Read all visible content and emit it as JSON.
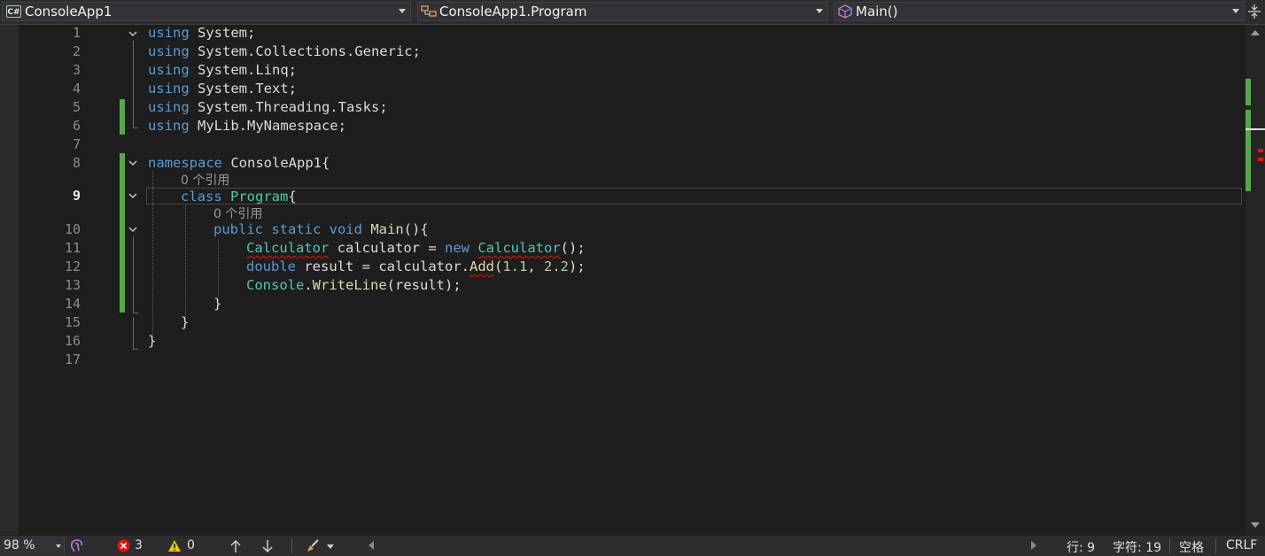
{
  "navbar": {
    "project": "ConsoleApp1",
    "project_icon": "C#",
    "class_scope": "ConsoleApp1.Program",
    "member_scope": "Main()"
  },
  "editor": {
    "line_numbers": [
      "1",
      "2",
      "3",
      "4",
      "5",
      "6",
      "7",
      "8",
      "9",
      "10",
      "11",
      "12",
      "13",
      "14",
      "15",
      "16",
      "17"
    ],
    "current_line": "9",
    "codelens_program": "0 个引用",
    "codelens_main": "0 个引用",
    "lines": {
      "l1": {
        "kw": "using",
        "rest": " System;"
      },
      "l2": {
        "kw": "using",
        "rest": " System.Collections.Generic;"
      },
      "l3": {
        "kw": "using",
        "rest": " System.Linq;"
      },
      "l4": {
        "kw": "using",
        "rest": " System.Text;"
      },
      "l5": {
        "kw": "using",
        "rest": " System.Threading.Tasks;"
      },
      "l6": {
        "kw": "using",
        "rest": " MyLib.MyNamespace;"
      },
      "l8": {
        "kw": "namespace",
        "rest": " ConsoleApp1{"
      },
      "l9": {
        "kw": "class",
        "name": "Program",
        "brace": "{"
      },
      "l10": {
        "mods": "public static void",
        "name": "Main",
        "rest": "(){"
      },
      "l11": {
        "type": "Calculator",
        "var": " calculator",
        "op": " = ",
        "kw": "new",
        "type2": "Calculator",
        "rest": "();"
      },
      "l12": {
        "kw": "double",
        "var": " result",
        "op": " = ",
        "obj": "calculator",
        "dot": ".",
        "meth": "Add",
        "open": "(",
        "n1": "1.1",
        "comma": ", ",
        "n2": "2.2",
        "close": ");"
      },
      "l13": {
        "type": "Console",
        "dot": ".",
        "meth": "WriteLine",
        "rest": "(result);"
      },
      "l14": {
        "brace": "}"
      },
      "l15": {
        "brace": "}"
      },
      "l16": {
        "brace": "}"
      }
    }
  },
  "status": {
    "zoom": "98 %",
    "errors": "3",
    "warnings": "0",
    "line_label": "行: 9",
    "char_label": "字符: 19",
    "spacing": "空格",
    "eol": "CRLF"
  },
  "colors": {
    "keyword": "#569cd6",
    "type": "#4ec9b0",
    "method": "#dcdcaa",
    "number": "#b5cea8",
    "change_marker": "#57a64a",
    "error": "#e51400"
  }
}
